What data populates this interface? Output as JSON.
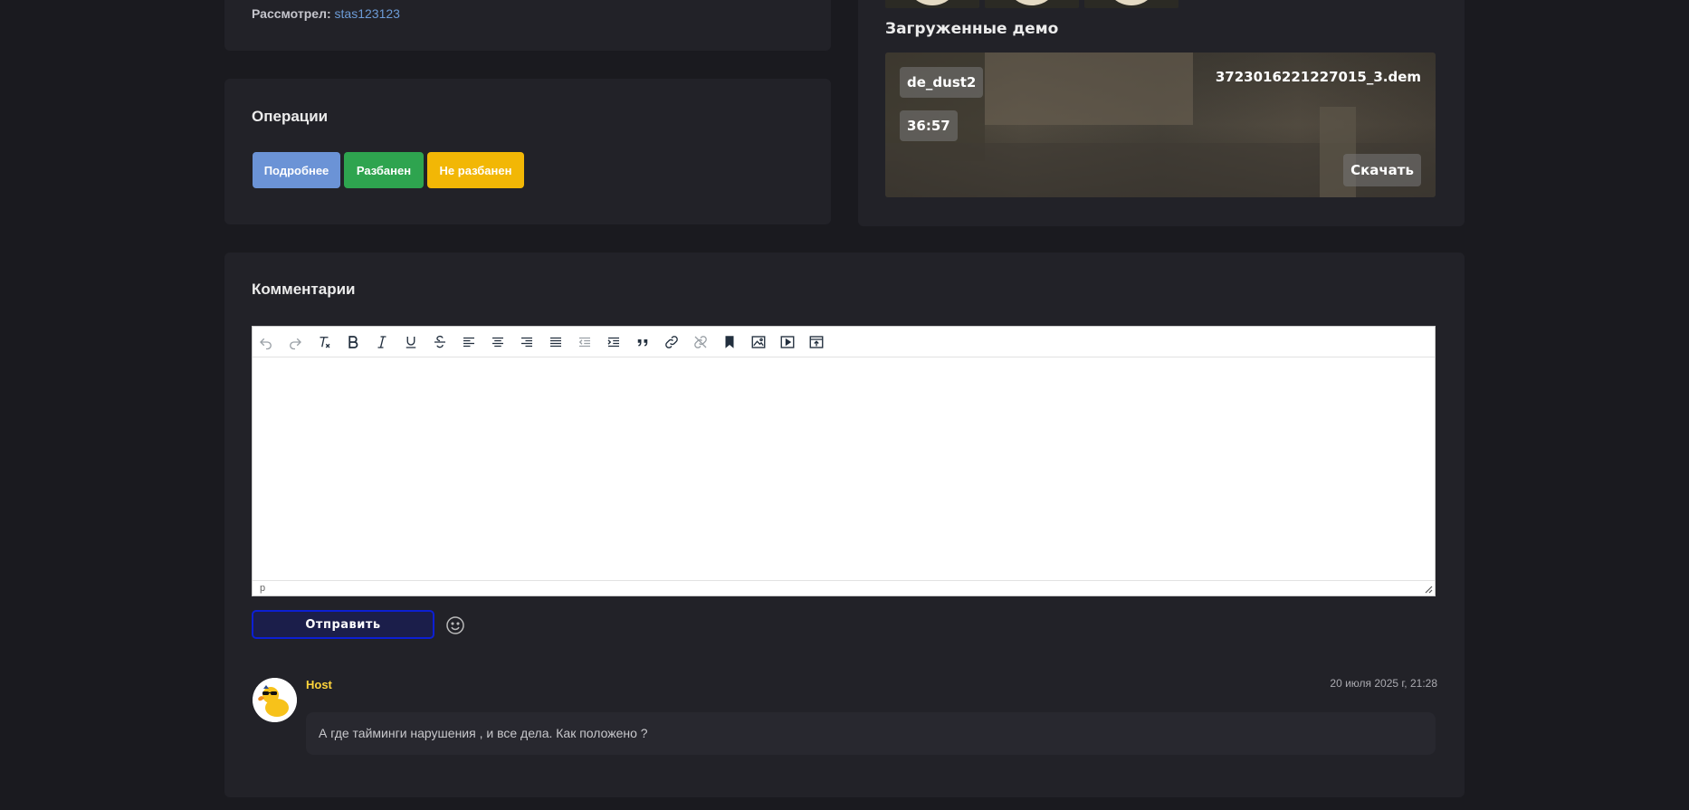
{
  "reviewer": {
    "label": "Рассмотрел:",
    "name": "stas123123"
  },
  "operations": {
    "title": "Операции",
    "buttons": {
      "detail": "Подробнее",
      "banned": "Разбанен",
      "not_banned": "Не разбанен"
    },
    "colors": {
      "detail": "#6b93d6",
      "banned": "#2ea44f",
      "not_banned": "#f2b705"
    }
  },
  "demos": {
    "title": "Загруженные демо",
    "item": {
      "map": "de_dust2",
      "duration": "36:57",
      "filename": "3723016221227015_3.dem",
      "download_label": "Скачать"
    }
  },
  "comments": {
    "title": "Комментарии",
    "editor": {
      "toolbar": [
        "undo-icon",
        "redo-icon",
        "clear-format-icon",
        "bold-icon",
        "italic-icon",
        "underline-icon",
        "strikethrough-icon",
        "align-left-icon",
        "align-center-icon",
        "align-right-icon",
        "align-justify-icon",
        "outdent-icon",
        "indent-icon",
        "blockquote-icon",
        "link-icon",
        "unlink-icon",
        "bookmark-icon",
        "image-icon",
        "media-icon",
        "upload-icon"
      ],
      "status_path": "p"
    },
    "send_label": "Отправить",
    "items": [
      {
        "author": "Host",
        "date": "20 июля 2025 г, 21:28",
        "text": "А где тайминги нарушения , и все дела. Как положено ?"
      }
    ]
  }
}
